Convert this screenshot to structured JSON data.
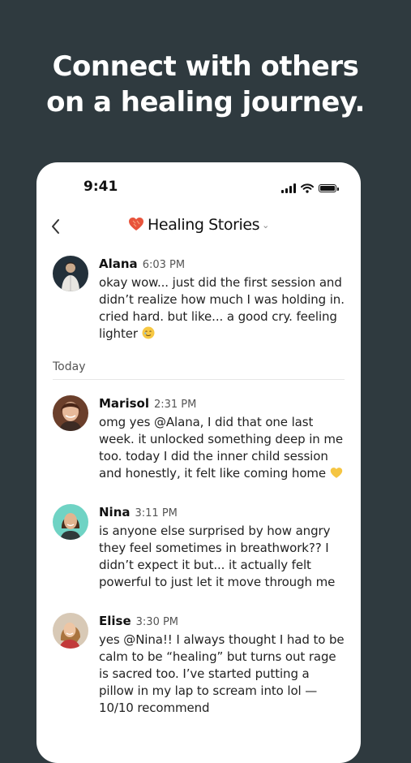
{
  "headline": {
    "line1": "Connect with others",
    "line2": "on a healing journey."
  },
  "status_bar": {
    "time": "9:41",
    "icons": [
      "signal-icon",
      "wifi-icon",
      "battery-icon"
    ]
  },
  "nav": {
    "back_icon": "chevron-left-icon",
    "channel_icon": "heart-icon",
    "title": "Healing Stories",
    "dropdown_icon": "chevron-down-icon"
  },
  "day_separator": "Today",
  "messages": [
    {
      "name": "Alana",
      "time": "6:03 PM",
      "text": "okay wow... just did the first session and\ndidn’t realize how much I was holding in.\ncried hard. but like... a good cry. feeling\nlighter",
      "emoji": "teary-smile-emoji"
    },
    {
      "name": "Marisol",
      "time": "2:31 PM",
      "text": "omg yes @Alana, I did that one last\nweek. it unlocked something deep in me\ntoo. today I did the inner child session\nand honestly, it felt like coming home",
      "emoji": "yellow-heart-emoji"
    },
    {
      "name": "Nina",
      "time": "3:11 PM",
      "text": "is anyone else surprised by how angry\nthey feel sometimes in breathwork?? I\ndidn’t expect it but... it actually felt\npowerful to just let it move through me"
    },
    {
      "name": "Elise",
      "time": "3:30 PM",
      "text": "yes @Nina!! I always thought I had to be\ncalm to be “healing” but turns out rage\nis sacred too. I’ve started putting a\npillow in my lap to scream into lol —\n10/10 recommend"
    }
  ],
  "colors": {
    "background": "#2f3a3f",
    "card": "#ffffff",
    "heart": "#e8543c"
  }
}
